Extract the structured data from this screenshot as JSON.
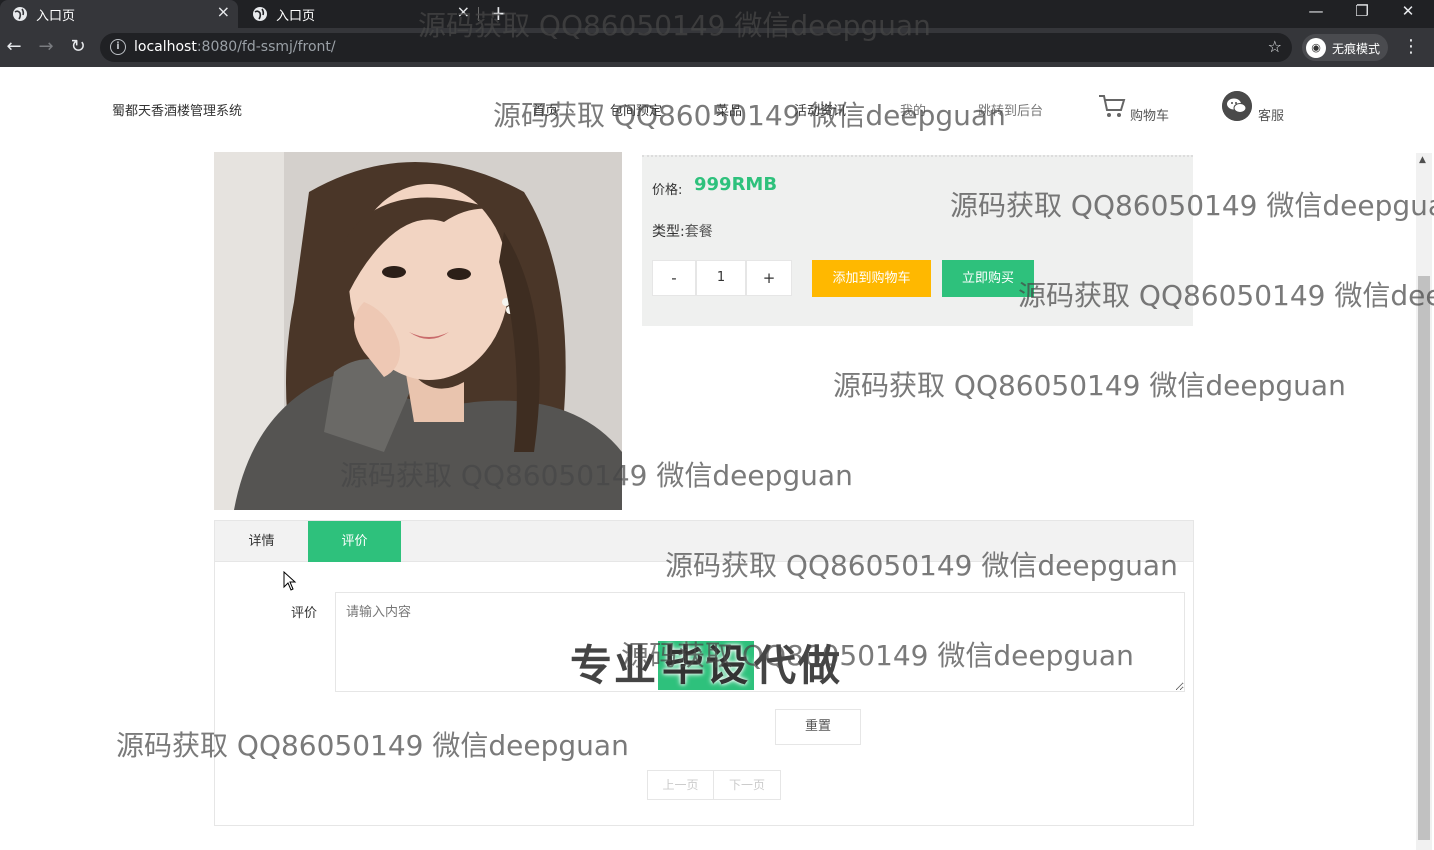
{
  "browser": {
    "tabs": [
      {
        "title": "入口页",
        "active": true
      },
      {
        "title": "入口页",
        "active": false
      }
    ],
    "url": {
      "host": "localhost",
      "path": ":8080/fd-ssmj/front/"
    },
    "incognito_label": "无痕模式",
    "window_controls": {
      "minimize": "—",
      "restore": "❐",
      "close": "✕"
    }
  },
  "header": {
    "site_title": "蜀都天香酒楼管理系统",
    "nav": [
      "首页",
      "包间预定",
      "菜品",
      "活动资讯",
      "我的",
      "跳转到后台"
    ],
    "cart_label": "购物车",
    "service_label": "客服"
  },
  "product": {
    "price_label": "价格:",
    "price_value": "999RMB",
    "type_label": "类型:",
    "type_value": "套餐",
    "quantity": "1",
    "minus": "-",
    "plus": "+",
    "add_to_cart": "添加到购物车",
    "buy_now": "立即购买"
  },
  "tabs": {
    "detail": "详情",
    "review": "评价",
    "active": "review"
  },
  "review_form": {
    "label": "评价",
    "placeholder": "请输入内容",
    "reset": "重置"
  },
  "pager": {
    "prev": "上一页",
    "next": "下一页"
  },
  "overlay": {
    "promo_prefix": "专业",
    "promo_highlight": "毕设",
    "promo_suffix": "代做",
    "watermark": "源码获取 QQ86050149 微信deepguan"
  },
  "colors": {
    "accent_green": "#2ec17c",
    "accent_yellow": "#ffb800",
    "info_bg": "#eff0ef"
  }
}
